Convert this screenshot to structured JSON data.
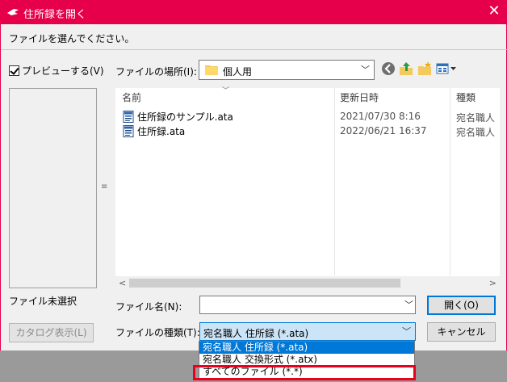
{
  "window": {
    "title": "住所録を開く",
    "close_glyph": "✕",
    "accent": "#e6004c"
  },
  "instruction": "ファイルを選んでください。",
  "preview": {
    "checkbox_label": "プレビューする(V)",
    "checked": true,
    "no_file_text": "ファイル未選択",
    "catalog_button": "カタログ表示(L)"
  },
  "location": {
    "label": "ファイルの場所(I):",
    "value": "個人用",
    "icons": [
      "back-icon",
      "up-folder-icon",
      "new-folder-icon",
      "view-menu-icon"
    ]
  },
  "file_list": {
    "columns": [
      "名前",
      "更新日時",
      "種類"
    ],
    "rows": [
      {
        "name": "住所録のサンプル.ata",
        "date": "2021/07/30 8:16",
        "type": "宛名職人"
      },
      {
        "name": "住所録.ata",
        "date": "2022/06/21 16:37",
        "type": "宛名職人"
      }
    ]
  },
  "filename": {
    "label": "ファイル名(N):",
    "value": ""
  },
  "filetype": {
    "label": "ファイルの種類(T):",
    "value": "宛名職人 住所録 (*.ata)",
    "options": [
      "宛名職人 住所録 (*.ata)",
      "宛名職人 交換形式 (*.atx)",
      "すべてのファイル (*.*)"
    ],
    "highlight_color": "#e8001c"
  },
  "buttons": {
    "open": "開く(O)",
    "cancel": "キャンセル"
  }
}
